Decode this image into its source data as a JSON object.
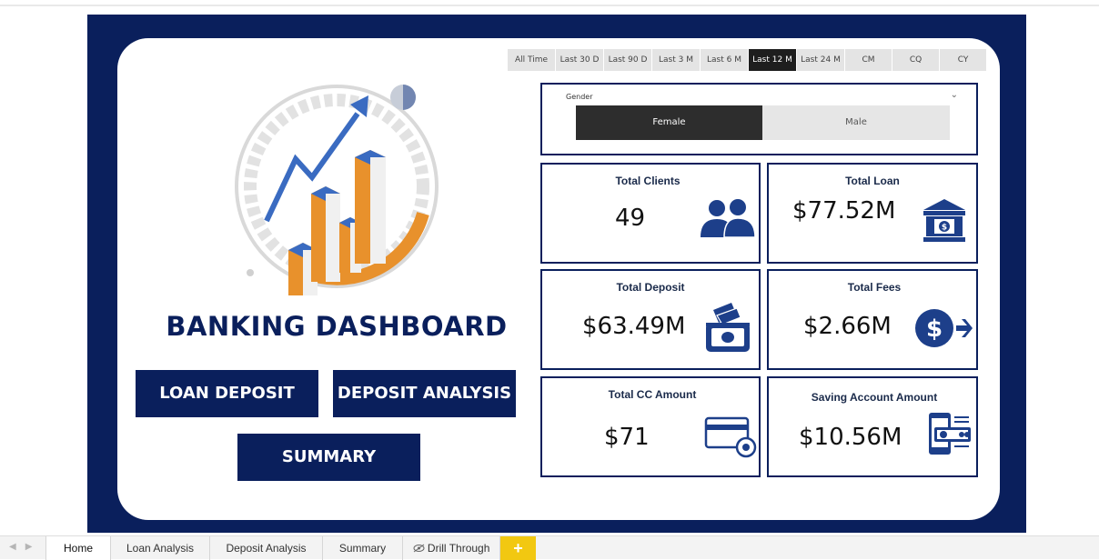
{
  "time_filters": [
    {
      "label": "All Time",
      "active": false
    },
    {
      "label": "Last 30 D",
      "active": false
    },
    {
      "label": "Last 90 D",
      "active": false
    },
    {
      "label": "Last 3 M",
      "active": false
    },
    {
      "label": "Last 6 M",
      "active": false
    },
    {
      "label": "Last 12 M",
      "active": true
    },
    {
      "label": "Last 24 M",
      "active": false
    },
    {
      "label": "CM",
      "active": false
    },
    {
      "label": "CQ",
      "active": false
    },
    {
      "label": "CY",
      "active": false
    }
  ],
  "gender_slicer": {
    "label": "Gender",
    "options": [
      "Female",
      "Male"
    ],
    "selected": "Female"
  },
  "kpis": {
    "total_clients": {
      "title": "Total Clients",
      "value": "49"
    },
    "total_loan": {
      "title": "Total Loan",
      "value": "$77.52M"
    },
    "total_deposit": {
      "title": "Total Deposit",
      "value": "$63.49M"
    },
    "total_fees": {
      "title": "Total Fees",
      "value": "$2.66M"
    },
    "total_cc_amount": {
      "title": "Total CC Amount",
      "value": "$71"
    },
    "saving_account_amount": {
      "title": "Saving Account Amount",
      "value": "$10.56M"
    }
  },
  "dashboard_title": "BANKING DASHBOARD",
  "nav_buttons": {
    "loan_deposit": "LOAN DEPOSIT",
    "deposit_analysis": "DEPOSIT ANALYSIS",
    "summary": "SUMMARY"
  },
  "page_tabs": [
    {
      "label": "Home",
      "active": true
    },
    {
      "label": "Loan Analysis",
      "active": false
    },
    {
      "label": "Deposit Analysis",
      "active": false
    },
    {
      "label": "Summary",
      "active": false
    },
    {
      "label": "Drill Through",
      "active": false,
      "hidden_icon": "eye-hidden-icon"
    }
  ],
  "colors": {
    "navy": "#0a1f5c",
    "icon_blue": "#1d3f8a",
    "orange": "#e8912c",
    "add_tab": "#f2c811"
  }
}
